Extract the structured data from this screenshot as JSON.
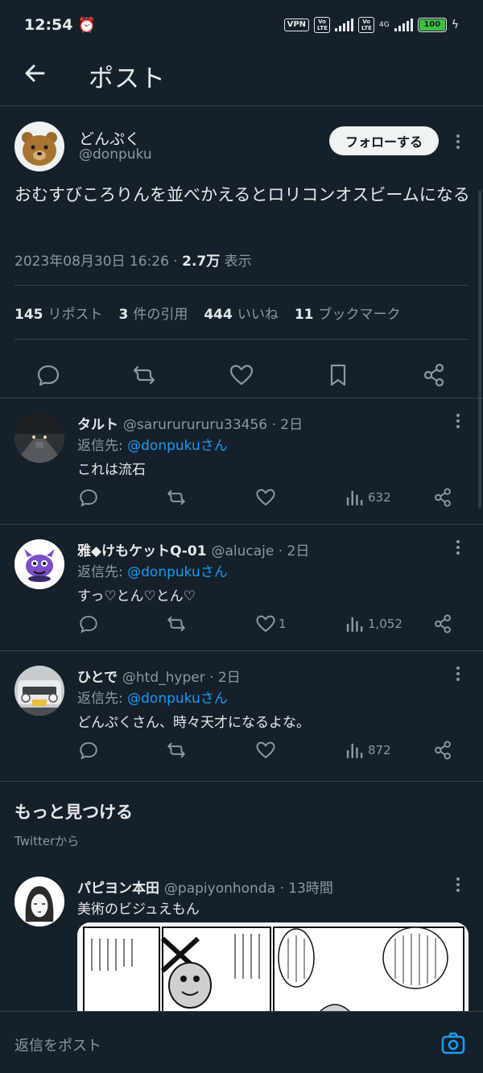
{
  "status_bar": {
    "time": "12:54",
    "vpn": "VPN",
    "volte1": "Vo LTE",
    "volte2": "Vo LTE",
    "network": "4G",
    "battery": "100"
  },
  "header": {
    "title": "ポスト"
  },
  "tweet": {
    "author_name": "どんぷく",
    "author_handle": "@donpuku",
    "follow_label": "フォローする",
    "text": "おむすびころりんを並べかえるとロリコンオスビームになる",
    "date": "2023年08月30日 16:26 · ",
    "views": "2.7万",
    "views_label": " 表示",
    "stats": [
      {
        "count": "145",
        "label": "リポスト"
      },
      {
        "count": "3",
        "label": "件の引用"
      },
      {
        "count": "444",
        "label": "いいね"
      },
      {
        "count": "11",
        "label": "ブックマーク"
      }
    ]
  },
  "replies": [
    {
      "name": "タルト",
      "handle": "@sarururururu33456 · 2日",
      "reply_to_prefix": "返信先: ",
      "reply_to": "@donpukuさん",
      "text": "これは流石",
      "likes": "",
      "views": "632"
    },
    {
      "name": "雅◆けもケットQ-01",
      "handle": "@alucaje · 2日",
      "reply_to_prefix": "返信先: ",
      "reply_to": "@donpukuさん",
      "text": "すっ♡とん♡とん♡",
      "likes": "1",
      "views": "1,052"
    },
    {
      "name": "ひとで",
      "handle": "@htd_hyper · 2日",
      "reply_to_prefix": "返信先: ",
      "reply_to": "@donpukuさん",
      "text": "どんぷくさん、時々天才になるよな。",
      "likes": "",
      "views": "872"
    }
  ],
  "discover": {
    "title": "もっと見つける",
    "subtitle": "Twitterから",
    "post": {
      "name": "パピヨン本田",
      "handle": "@papiyonhonda · 13時間",
      "text": "美術のビジュえもん"
    }
  },
  "composer": {
    "placeholder": "返信をポスト"
  },
  "colors": {
    "background": "#15202b",
    "accent": "#1d9bf0",
    "muted": "#8b98a5",
    "divider": "#38444d"
  }
}
